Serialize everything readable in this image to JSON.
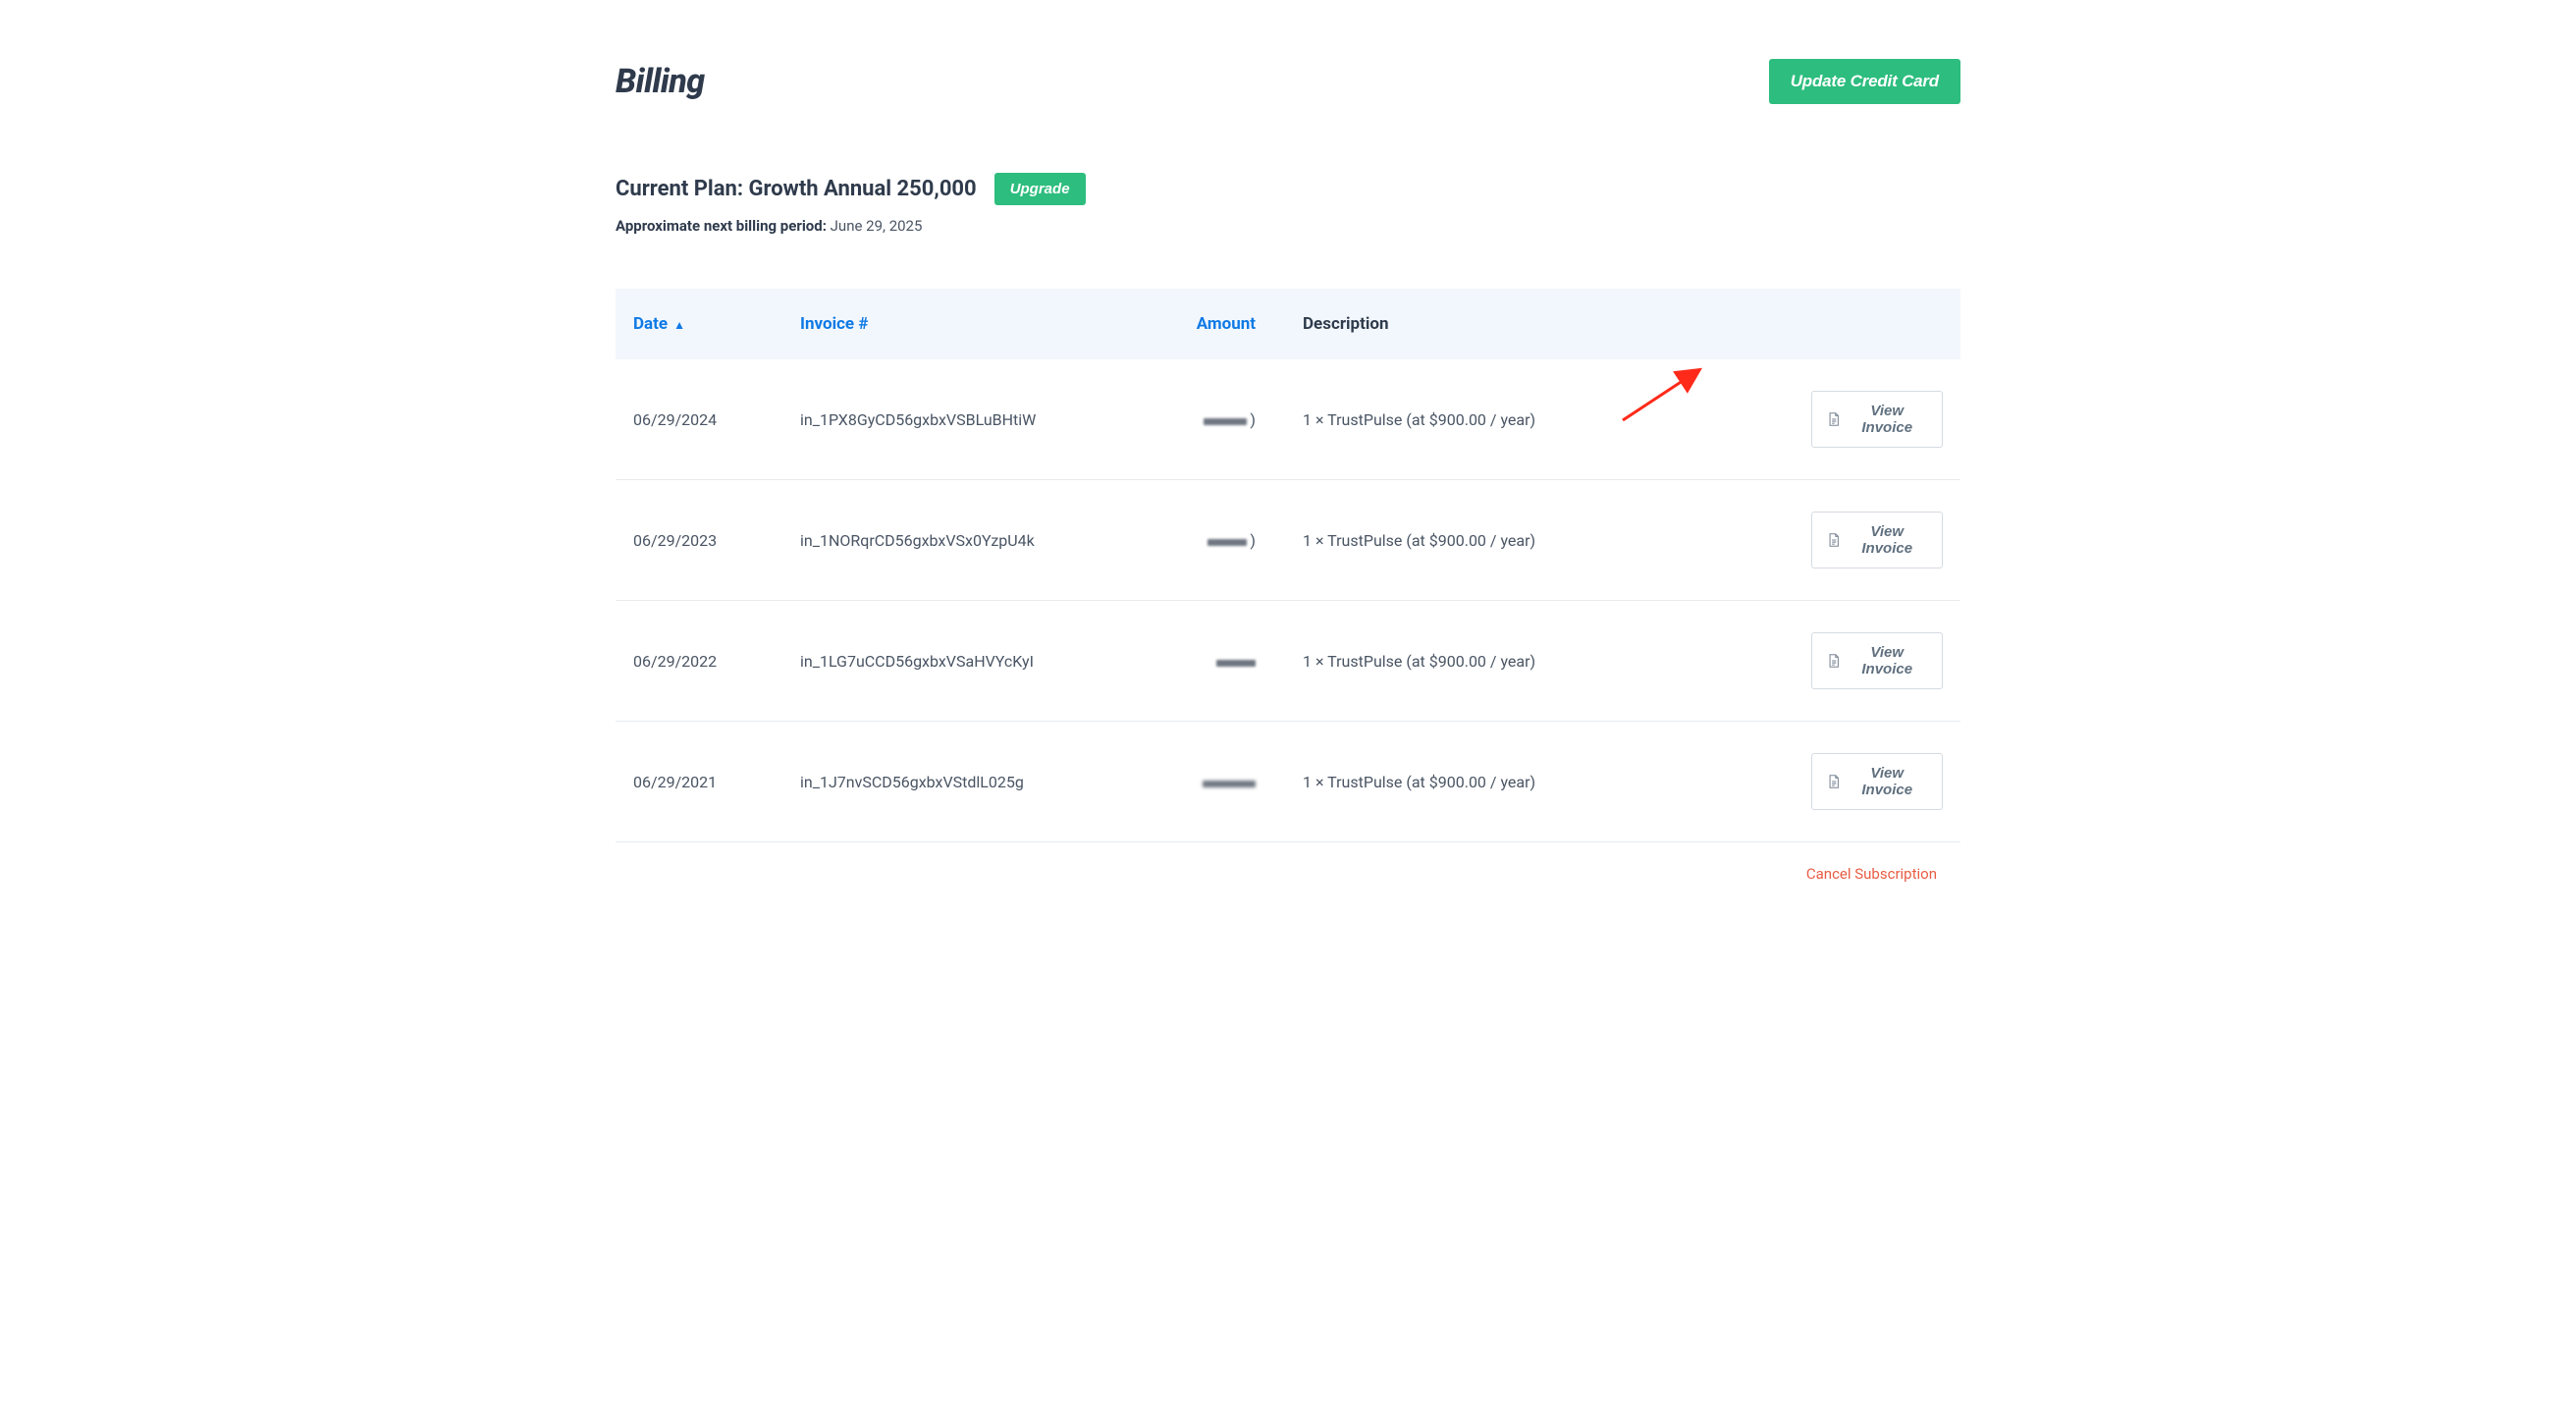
{
  "header": {
    "title": "Billing",
    "update_card_label": "Update Credit Card"
  },
  "plan": {
    "label": "Current Plan: Growth Annual 250,000",
    "upgrade_label": "Upgrade",
    "next_billing_label": "Approximate next billing period: ",
    "next_billing_date": "June 29, 2025"
  },
  "table": {
    "headers": {
      "date": "Date",
      "invoice_num": "Invoice #",
      "amount": "Amount",
      "description": "Description"
    },
    "view_label": "View Invoice",
    "rows": [
      {
        "date": "06/29/2024",
        "invoice_id": "in_1PX8GyCD56gxbxVSBLuBHtiW",
        "description": "1 × TrustPulse (at $900.00 / year)"
      },
      {
        "date": "06/29/2023",
        "invoice_id": "in_1NORqrCD56gxbxVSx0YzpU4k",
        "description": "1 × TrustPulse (at $900.00 / year)"
      },
      {
        "date": "06/29/2022",
        "invoice_id": "in_1LG7uCCD56gxbxVSaHVYcKyI",
        "description": "1 × TrustPulse (at $900.00 / year)"
      },
      {
        "date": "06/29/2021",
        "invoice_id": "in_1J7nvSCD56gxbxVStdlL025g",
        "description": "1 × TrustPulse (at $900.00 / year)"
      }
    ]
  },
  "footer": {
    "cancel_label": "Cancel Subscription"
  }
}
